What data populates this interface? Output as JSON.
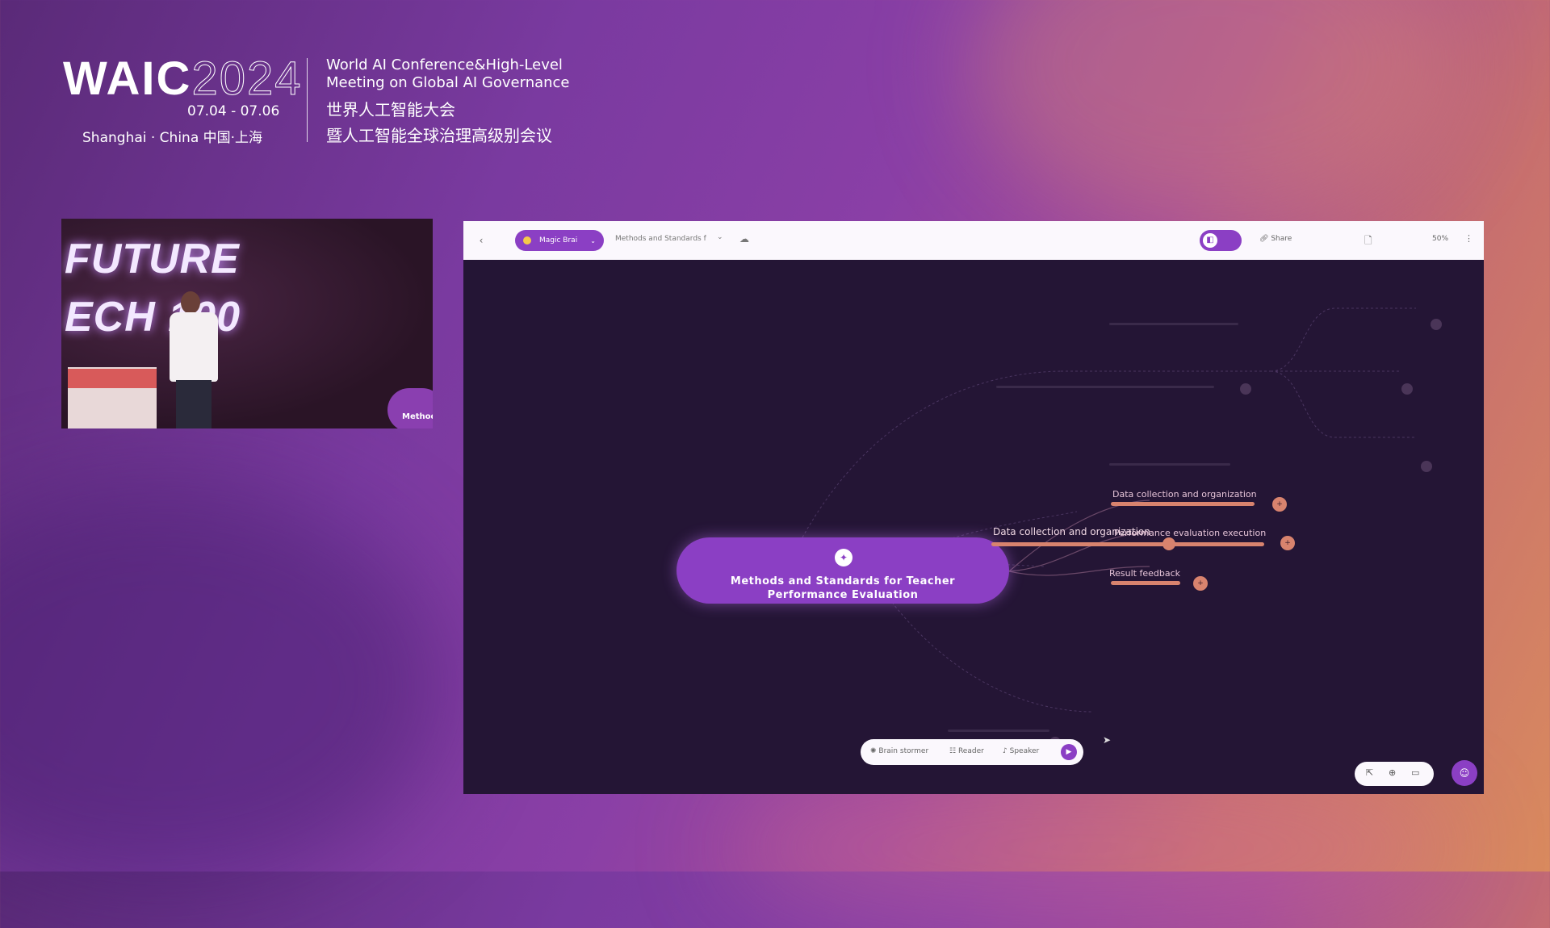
{
  "header": {
    "logo": "WAIC",
    "year": "2024",
    "dates": "07.04 - 07.06",
    "city": "Shanghai · China  中国·上海",
    "title_en_1": "World AI Conference&High-Level",
    "title_en_2": "Meeting on Global AI Governance",
    "title_cn_1": "世界人工智能大会",
    "title_cn_2": "暨人工智能全球治理高级别会议"
  },
  "camera": {
    "stage_text_1": "FUTURE",
    "stage_text_2": "ECH 100",
    "screen_chip": "Method"
  },
  "toolbar": {
    "back_icon": "‹",
    "magic_label": "Magic Brai",
    "doc_title": "Methods and Standards f",
    "share_label": "Share",
    "zoom_label": "50%",
    "more_icon": "⋮"
  },
  "canvas": {
    "root_title": "Methods and Standards for Teacher Performance Evaluation",
    "branches": [
      {
        "label": "Data collection and organization"
      },
      {
        "label": "Performance evaluation execution"
      },
      {
        "label": "Result feedback"
      }
    ],
    "overlap_label": "Data collection and organization"
  },
  "mode_bar": {
    "brainstormer": "Brain stormer",
    "reader": "Reader",
    "speaker": "Speaker"
  },
  "colors": {
    "accent": "#8b3fc4",
    "branch": "#d8836e",
    "canvas_bg": "#241535"
  }
}
